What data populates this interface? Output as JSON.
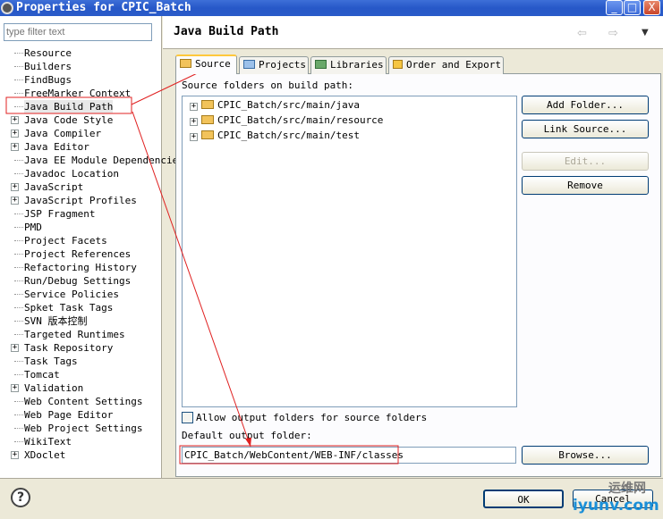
{
  "window": {
    "title": "Properties for CPIC_Batch",
    "minimize": "_",
    "maximize": "□",
    "close": "X"
  },
  "sidebar": {
    "filter_placeholder": "type filter text",
    "items": [
      {
        "label": "Resource",
        "expandable": false
      },
      {
        "label": "Builders",
        "expandable": false
      },
      {
        "label": "FindBugs",
        "expandable": false
      },
      {
        "label": "FreeMarker Context",
        "expandable": false
      },
      {
        "label": "Java Build Path",
        "expandable": false,
        "selected": true
      },
      {
        "label": "Java Code Style",
        "expandable": true
      },
      {
        "label": "Java Compiler",
        "expandable": true
      },
      {
        "label": "Java Editor",
        "expandable": true
      },
      {
        "label": "Java EE Module Dependencies",
        "expandable": false
      },
      {
        "label": "Javadoc Location",
        "expandable": false
      },
      {
        "label": "JavaScript",
        "expandable": true
      },
      {
        "label": "JavaScript Profiles",
        "expandable": true
      },
      {
        "label": "JSP Fragment",
        "expandable": false
      },
      {
        "label": "PMD",
        "expandable": false
      },
      {
        "label": "Project Facets",
        "expandable": false
      },
      {
        "label": "Project References",
        "expandable": false
      },
      {
        "label": "Refactoring History",
        "expandable": false
      },
      {
        "label": "Run/Debug Settings",
        "expandable": false
      },
      {
        "label": "Service Policies",
        "expandable": false
      },
      {
        "label": "Spket Task Tags",
        "expandable": false
      },
      {
        "label": "SVN 版本控制",
        "expandable": false
      },
      {
        "label": "Targeted Runtimes",
        "expandable": false
      },
      {
        "label": "Task Repository",
        "expandable": true
      },
      {
        "label": "Task Tags",
        "expandable": false
      },
      {
        "label": "Tomcat",
        "expandable": false
      },
      {
        "label": "Validation",
        "expandable": true
      },
      {
        "label": "Web Content Settings",
        "expandable": false
      },
      {
        "label": "Web Page Editor",
        "expandable": false
      },
      {
        "label": "Web Project Settings",
        "expandable": false
      },
      {
        "label": "WikiText",
        "expandable": false
      },
      {
        "label": "XDoclet",
        "expandable": true
      }
    ]
  },
  "main": {
    "title": "Java Build Path",
    "tabs": [
      {
        "label": "Source",
        "active": true
      },
      {
        "label": "Projects"
      },
      {
        "label": "Libraries"
      },
      {
        "label": "Order and Export"
      }
    ],
    "source_label": "Source folders on build path:",
    "folders": [
      "CPIC_Batch/src/main/java",
      "CPIC_Batch/src/main/resource",
      "CPIC_Batch/src/main/test"
    ],
    "buttons": {
      "add_folder": "Add Folder...",
      "link_source": "Link Source...",
      "edit": "Edit...",
      "remove": "Remove",
      "browse": "Browse..."
    },
    "allow_output_label": "Allow output folders for source folders",
    "allow_output_checked": false,
    "default_output_label": "Default output folder:",
    "default_output_value": "CPIC_Batch/WebContent/WEB-INF/classes"
  },
  "footer": {
    "help": "?",
    "ok": "OK",
    "cancel": "Cancel"
  },
  "watermark": {
    "line1": "运维网",
    "line2": "iyunv.com"
  },
  "colors": {
    "annotation": "#e02020",
    "titlebar": "#2758c8"
  }
}
